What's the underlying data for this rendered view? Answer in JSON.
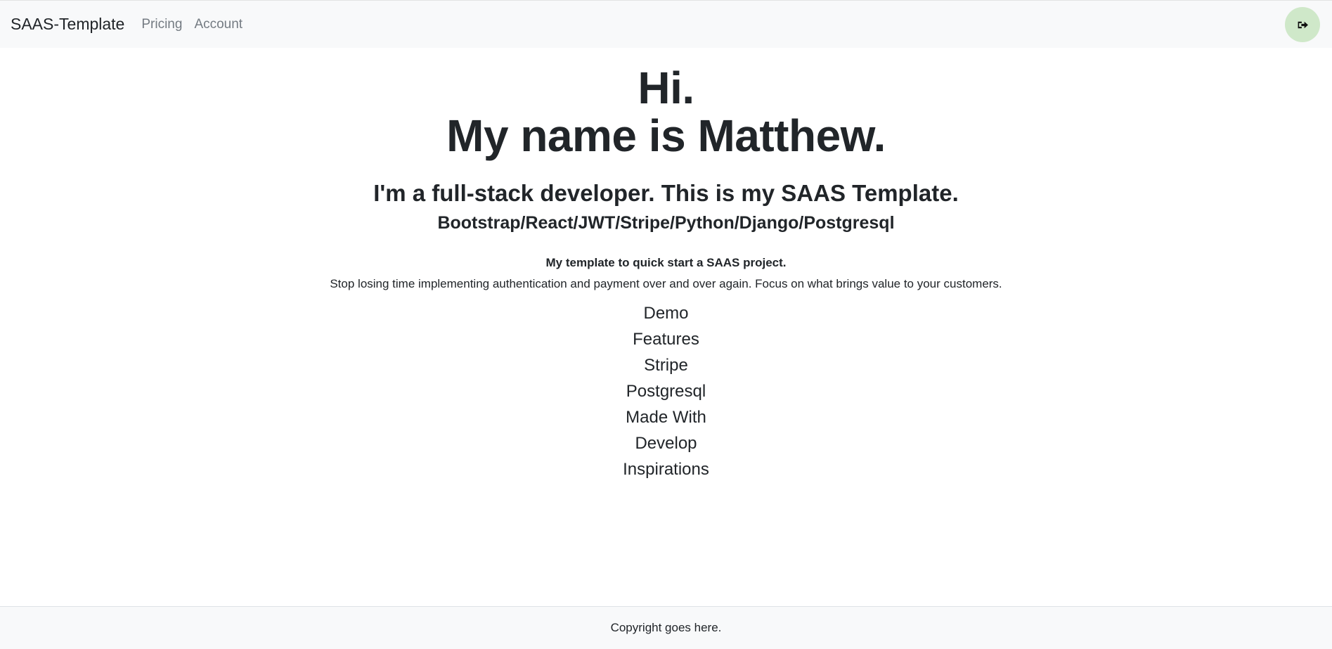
{
  "navbar": {
    "brand": "SAAS-Template",
    "links": [
      "Pricing",
      "Account"
    ],
    "logout_icon": "sign-out-icon",
    "logout_bg": "#cfe8c9"
  },
  "hero": {
    "title_line1": "Hi.",
    "title_line2": "My name is Matthew.",
    "tagline": "I'm a full-stack developer. This is my SAAS Template.",
    "stack": "Bootstrap/React/JWT/Stripe/Python/Django/Postgresql",
    "intro_strong": "My template to quick start a SAAS project.",
    "intro": "Stop losing time implementing authentication and payment over and over again. Focus on what brings value to your customers."
  },
  "sections": [
    "Demo",
    "Features",
    "Stripe",
    "Postgresql",
    "Made With",
    "Develop",
    "Inspirations"
  ],
  "footer": {
    "text": "Copyright goes here."
  }
}
